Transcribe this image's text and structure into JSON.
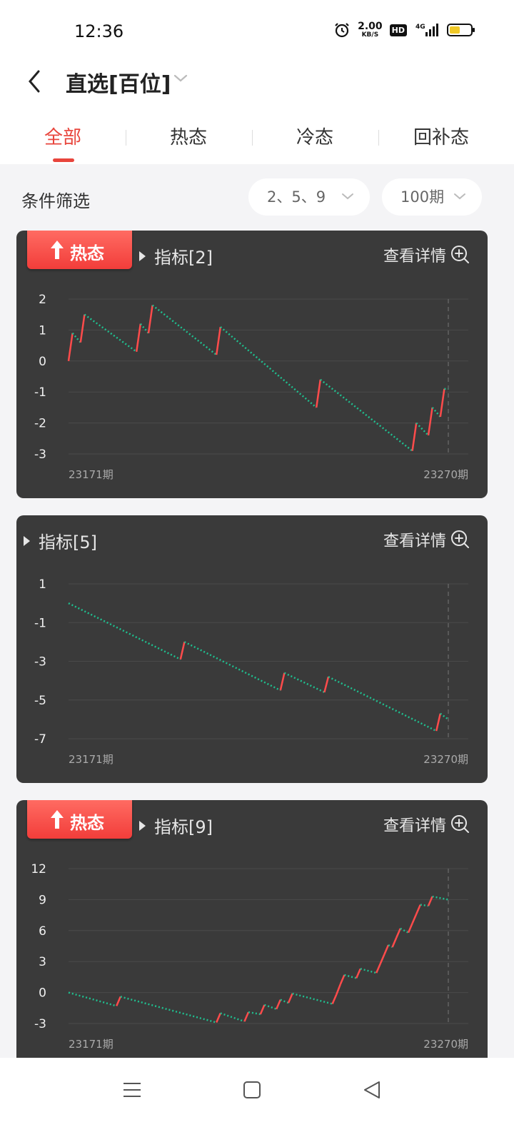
{
  "status": {
    "time": "12:36",
    "speed_value": "2.00",
    "speed_unit": "KB/S",
    "hd": "HD",
    "network": "4G"
  },
  "header": {
    "title": "直选[百位]"
  },
  "tabs": [
    {
      "label": "全部",
      "active": true
    },
    {
      "label": "热态",
      "active": false
    },
    {
      "label": "冷态",
      "active": false
    },
    {
      "label": "回补态",
      "active": false
    }
  ],
  "filter": {
    "label": "条件筛选",
    "numbers": "2、5、9",
    "periods": "100期"
  },
  "cards": [
    {
      "badge": "热态",
      "indicator": "指标[2]",
      "detail": "查看详情"
    },
    {
      "badge": "",
      "indicator": "指标[5]",
      "detail": "查看详情"
    },
    {
      "badge": "热态",
      "indicator": "指标[9]",
      "detail": "查看详情"
    }
  ],
  "chart_data": [
    {
      "type": "line",
      "x_start": "23171期",
      "x_end": "23270期",
      "yticks": [
        2,
        1,
        0,
        -1,
        -2,
        -3
      ],
      "ylim": [
        -3,
        2
      ],
      "colors": {
        "up": "#ff4b4b",
        "down": "#1fbf8f"
      },
      "points": [
        [
          0,
          0
        ],
        [
          1,
          0.9
        ],
        [
          3,
          0.6
        ],
        [
          4,
          1.5
        ],
        [
          17,
          0.3
        ],
        [
          18,
          1.2
        ],
        [
          20,
          0.9
        ],
        [
          21,
          1.8
        ],
        [
          37,
          0.2
        ],
        [
          38,
          1.1
        ],
        [
          62,
          -1.5
        ],
        [
          63,
          -0.6
        ],
        [
          86,
          -2.9
        ],
        [
          87,
          -2
        ],
        [
          90,
          -2.4
        ],
        [
          91,
          -1.5
        ],
        [
          93,
          -1.8
        ],
        [
          94,
          -0.9
        ],
        [
          95,
          -0.9
        ]
      ]
    },
    {
      "type": "line",
      "x_start": "23171期",
      "x_end": "23270期",
      "yticks": [
        1,
        -1,
        -3,
        -5,
        -7
      ],
      "ylim": [
        -7,
        1
      ],
      "colors": {
        "up": "#ff4b4b",
        "down": "#1fbf8f"
      },
      "points": [
        [
          0,
          0
        ],
        [
          28,
          -2.9
        ],
        [
          29,
          -2
        ],
        [
          53,
          -4.5
        ],
        [
          54,
          -3.6
        ],
        [
          64,
          -4.6
        ],
        [
          65,
          -3.8
        ],
        [
          92,
          -6.6
        ],
        [
          93,
          -5.7
        ],
        [
          95,
          -6
        ]
      ]
    },
    {
      "type": "line",
      "x_start": "23171期",
      "x_end": "23270期",
      "yticks": [
        12,
        9,
        6,
        3,
        0,
        -3
      ],
      "ylim": [
        -3,
        12
      ],
      "colors": {
        "up": "#ff4b4b",
        "down": "#1fbf8f"
      },
      "points": [
        [
          0,
          0
        ],
        [
          12,
          -1.3
        ],
        [
          13,
          -0.4
        ],
        [
          37,
          -2.9
        ],
        [
          38,
          -2
        ],
        [
          44,
          -2.8
        ],
        [
          45,
          -1.9
        ],
        [
          48,
          -2.1
        ],
        [
          49,
          -1.2
        ],
        [
          52,
          -1.6
        ],
        [
          53,
          -0.7
        ],
        [
          55,
          -1
        ],
        [
          56,
          -0.1
        ],
        [
          66,
          -1.1
        ],
        [
          67,
          -0.2
        ],
        [
          68,
          0.8
        ],
        [
          69,
          1.7
        ],
        [
          72,
          1.4
        ],
        [
          73,
          2.3
        ],
        [
          77,
          1.9
        ],
        [
          78,
          2.8
        ],
        [
          79,
          3.7
        ],
        [
          80,
          4.6
        ],
        [
          81,
          4.4
        ],
        [
          82,
          5.3
        ],
        [
          83,
          6.2
        ],
        [
          85,
          5.8
        ],
        [
          86,
          6.7
        ],
        [
          87,
          7.6
        ],
        [
          88,
          8.5
        ],
        [
          90,
          8.4
        ],
        [
          91,
          9.3
        ],
        [
          95,
          9
        ]
      ]
    }
  ]
}
